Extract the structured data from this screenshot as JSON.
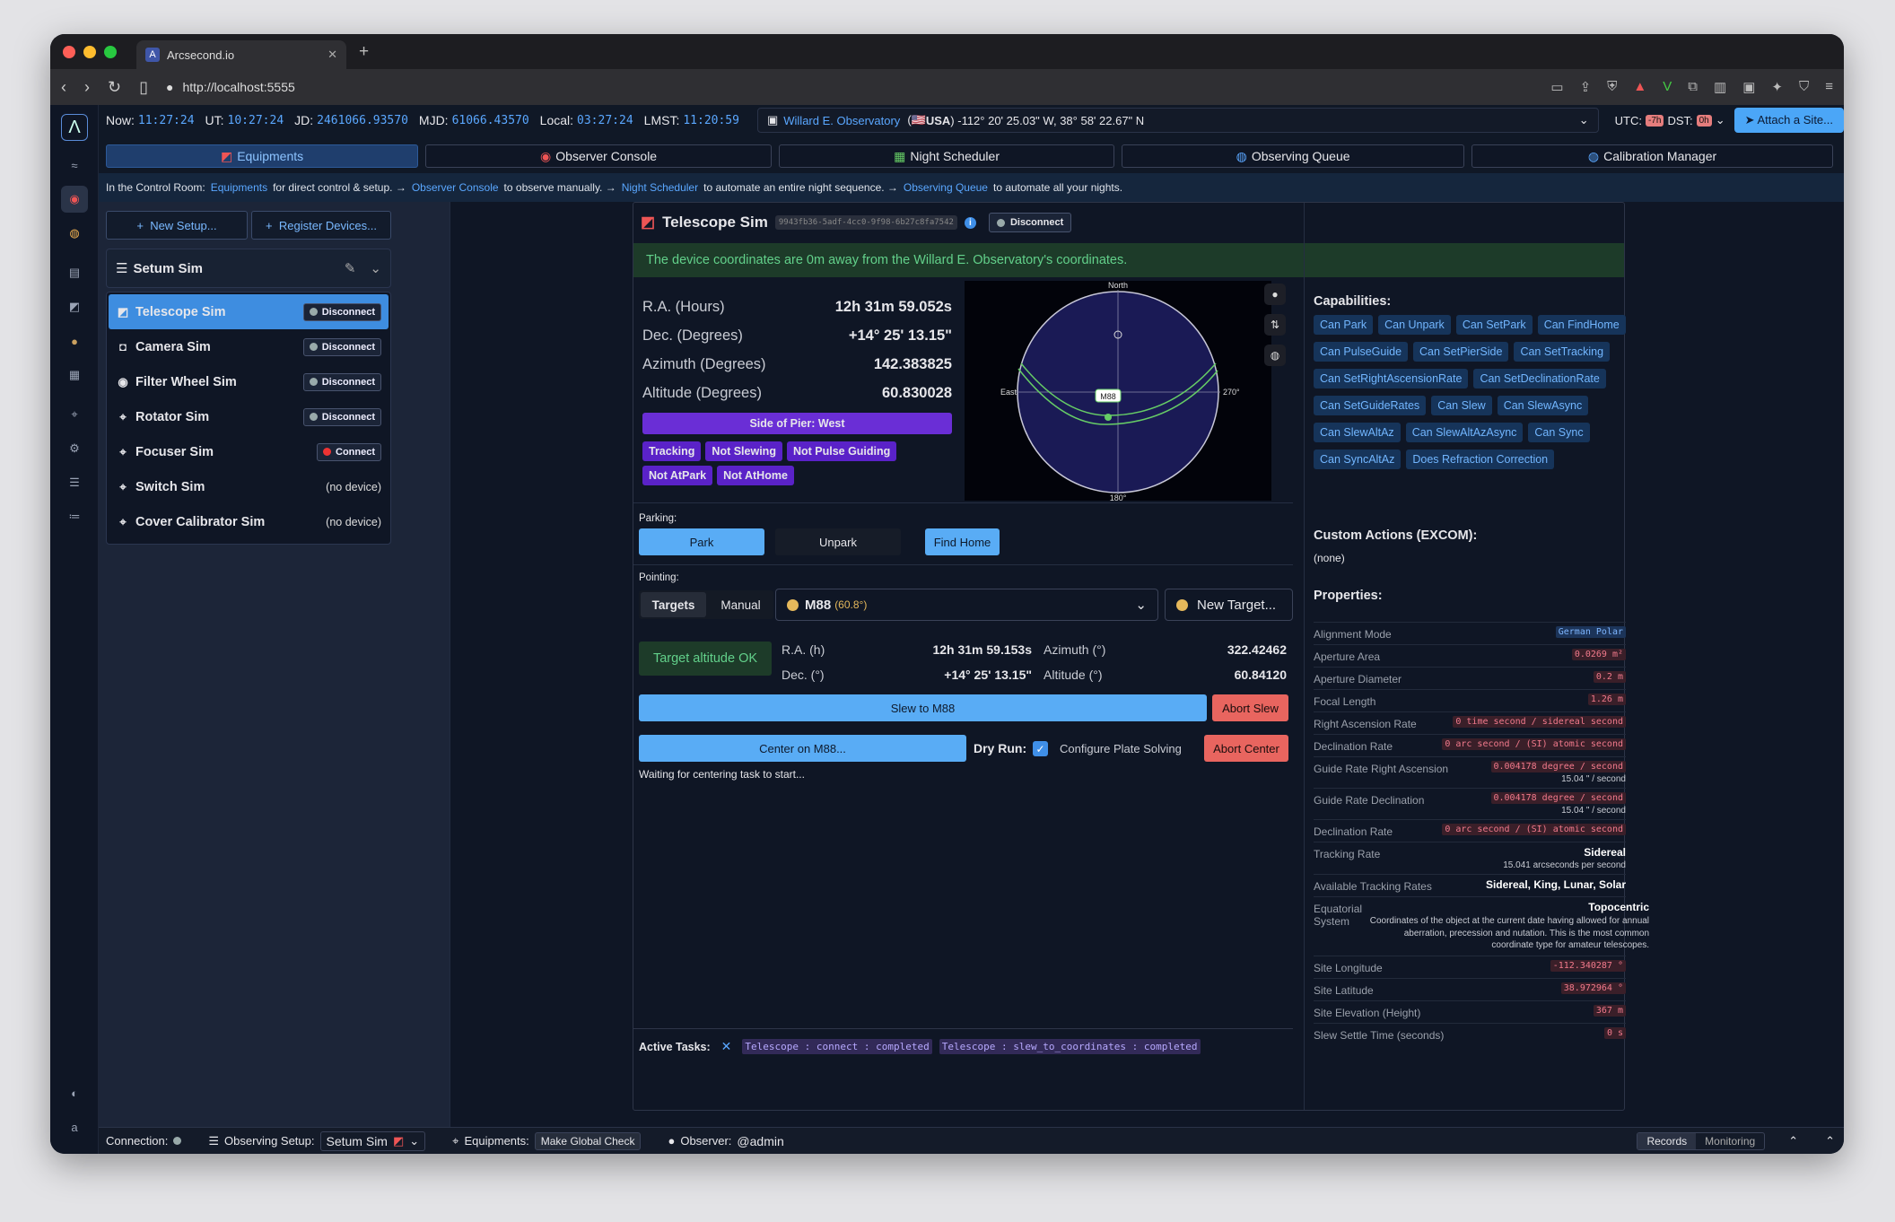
{
  "browser": {
    "tab_title": "Arcsecond.io",
    "tab_icon": "A",
    "url": "http://localhost:5555"
  },
  "info": {
    "now_label": "Now:",
    "now": "11:27:24",
    "ut_label": "UT:",
    "ut": "10:27:24",
    "jd_label": "JD:",
    "jd": "2461066.93570",
    "mjd_label": "MJD:",
    "mjd": "61066.43570",
    "local_label": "Local:",
    "local": "03:27:24",
    "lmst_label": "LMST:",
    "lmst": "11:20:59",
    "observatory": "Willard E. Observatory",
    "country": "USA",
    "location": "-112° 20' 25.03\" W, 38° 58' 22.67\" N",
    "utc_label": "UTC:",
    "utc_offset": "-7h",
    "dst_label": "DST:",
    "dst": "0h",
    "attach": "Attach a Site..."
  },
  "tabs": [
    {
      "label": "Equipments"
    },
    {
      "label": "Observer Console"
    },
    {
      "label": "Night Scheduler"
    },
    {
      "label": "Observing Queue"
    },
    {
      "label": "Calibration Manager"
    }
  ],
  "hint": {
    "p1": "In the Control Room:",
    "l1": "Equipments",
    "p2": "for direct control & setup. →",
    "l2": "Observer Console",
    "p3": "to observe manually. →",
    "l3": "Night Scheduler",
    "p4": "to automate an entire night sequence. →",
    "l4": "Observing Queue",
    "p5": "to automate all your nights."
  },
  "sidebar": {
    "new_setup": "New Setup...",
    "register": "Register Devices...",
    "setup_name": "Setum Sim",
    "devices": [
      {
        "name": "Telescope Sim",
        "action": "Disconnect"
      },
      {
        "name": "Camera Sim",
        "action": "Disconnect"
      },
      {
        "name": "Filter Wheel Sim",
        "action": "Disconnect"
      },
      {
        "name": "Rotator Sim",
        "action": "Disconnect"
      },
      {
        "name": "Focuser Sim",
        "action": "Connect"
      },
      {
        "name": "Switch Sim",
        "action": "(no device)"
      },
      {
        "name": "Cover Calibrator Sim",
        "action": "(no device)"
      }
    ]
  },
  "device": {
    "title": "Telescope Sim",
    "uuid": "9943fb36-5adf-4cc0-9f98-6b27c8fa7542",
    "disconnect": "Disconnect",
    "banner": "The device coordinates are 0m away from the Willard E. Observatory's coordinates.",
    "coords": [
      {
        "label": "R.A. (Hours)",
        "value": "12h 31m 59.052s"
      },
      {
        "label": "Dec. (Degrees)",
        "value": "+14° 25' 13.15\""
      },
      {
        "label": "Azimuth (Degrees)",
        "value": "142.383825"
      },
      {
        "label": "Altitude (Degrees)",
        "value": "60.830028"
      }
    ],
    "pier": "Side of Pier: West",
    "badges": [
      "Tracking",
      "Not Slewing",
      "Not Pulse Guiding",
      "Not AtPark",
      "Not AtHome"
    ],
    "sky": {
      "north": "North",
      "east": "East",
      "west": "270°",
      "south": "180°",
      "target": "M88"
    },
    "parking_label": "Parking:",
    "park": "Park",
    "unpark": "Unpark",
    "find_home": "Find Home",
    "pointing_label": "Pointing:",
    "tab_targets": "Targets",
    "tab_manual": "Manual",
    "target_name": "M88",
    "target_alt": "(60.8°)",
    "new_target": "New Target...",
    "target_ok": "Target altitude OK",
    "t_ra_label": "R.A. (h)",
    "t_ra": "12h 31m 59.153s",
    "t_dec_label": "Dec. (°)",
    "t_dec": "+14° 25' 13.15\"",
    "t_az_label": "Azimuth (°)",
    "t_az": "322.42462",
    "t_alt_label": "Altitude (°)",
    "t_alt": "60.84120",
    "slew": "Slew to M88",
    "abort_slew": "Abort Slew",
    "center": "Center on M88...",
    "dry_run": "Dry Run:",
    "configure": "Configure Plate Solving",
    "abort_center": "Abort Center",
    "waiting": "Waiting for centering task to start...",
    "active_tasks": "Active Tasks:",
    "tasks": [
      "Telescope : connect : completed",
      "Telescope : slew_to_coordinates : completed"
    ]
  },
  "capabilities": {
    "title": "Capabilities:",
    "items": [
      "Can Park",
      "Can Unpark",
      "Can SetPark",
      "Can FindHome",
      "Can PulseGuide",
      "Can SetPierSide",
      "Can SetTracking",
      "Can SetRightAscensionRate",
      "Can SetDeclinationRate",
      "Can SetGuideRates",
      "Can Slew",
      "Can SlewAsync",
      "Can SlewAltAz",
      "Can SlewAltAzAsync",
      "Can Sync",
      "Can SyncAltAz",
      "Does Refraction Correction"
    ],
    "custom_title": "Custom Actions (EXCOM):",
    "custom_value": "(none)",
    "props_title": "Properties:",
    "props": [
      {
        "k": "Alignment Mode",
        "v": "German Polar",
        "style": "blue"
      },
      {
        "k": "Aperture Area",
        "v": "0.0269 m²",
        "style": "code"
      },
      {
        "k": "Aperture Diameter",
        "v": "0.2 m",
        "style": "code"
      },
      {
        "k": "Focal Length",
        "v": "1.26 m",
        "style": "code"
      },
      {
        "k": "Right Ascension Rate",
        "v": "0 time second / sidereal second",
        "style": "code"
      },
      {
        "k": "Declination Rate",
        "v": "0 arc second / (SI) atomic second",
        "style": "code"
      },
      {
        "k": "Guide Rate Right Ascension",
        "v": "0.004178 degree / second",
        "style": "code",
        "sub": "15.04 \" / second"
      },
      {
        "k": "Guide Rate Declination",
        "v": "0.004178 degree / second",
        "style": "code",
        "sub": "15.04 \" / second"
      },
      {
        "k": "Declination Rate",
        "v": "0 arc second / (SI) atomic second",
        "style": "code"
      },
      {
        "k": "Tracking Rate",
        "v": "Sidereal",
        "style": "bold",
        "sub": "15.041 arcseconds per second"
      },
      {
        "k": "Available Tracking Rates",
        "v": "Sidereal, King, Lunar, Solar",
        "style": "bold"
      },
      {
        "k": "Equatorial System",
        "v": "Topocentric",
        "style": "bold",
        "desc": "Coordinates of the object at the current date having allowed for annual aberration, precession and nutation. This is the most common coordinate type for amateur telescopes."
      },
      {
        "k": "Site Longitude",
        "v": "-112.340287 °",
        "style": "code"
      },
      {
        "k": "Site Latitude",
        "v": "38.972964 °",
        "style": "code"
      },
      {
        "k": "Site Elevation (Height)",
        "v": "367 m",
        "style": "code"
      },
      {
        "k": "Slew Settle Time (seconds)",
        "v": "0 s",
        "style": "code"
      }
    ]
  },
  "status": {
    "connection": "Connection:",
    "setup_label": "Observing Setup:",
    "setup_value": "Setum Sim",
    "equip_label": "Equipments:",
    "global_check": "Make Global Check",
    "observer_label": "Observer:",
    "observer": "@admin",
    "records": "Records",
    "monitoring": "Monitoring"
  },
  "colors": {
    "accent": "#5aa7ff",
    "success": "#62d08a",
    "danger": "#e8655f",
    "purple": "#5a22c8"
  }
}
